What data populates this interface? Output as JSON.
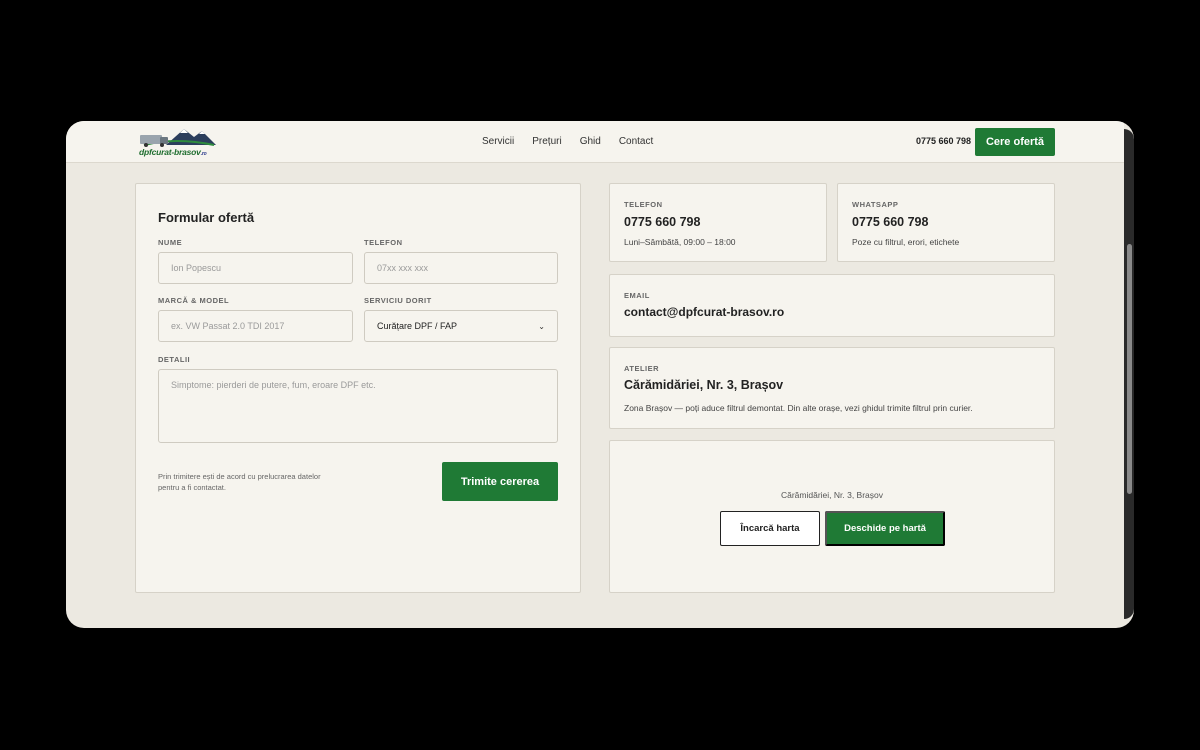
{
  "header": {
    "logo_text": "dpfcurat-brasov",
    "logo_tld": ".ro",
    "nav": [
      "Servicii",
      "Prețuri",
      "Ghid",
      "Contact"
    ],
    "phone": "0775 660 798",
    "cta_label": "Cere ofertă"
  },
  "form": {
    "title": "Formular ofertă",
    "name_label": "NUME",
    "name_placeholder": "Ion Popescu",
    "phone_label": "TELEFON",
    "phone_placeholder": "07xx xxx xxx",
    "model_label": "MARCĂ & MODEL",
    "model_placeholder": "ex. VW Passat 2.0 TDI 2017",
    "service_label": "SERVICIU DORIT",
    "service_value": "Curățare DPF / FAP",
    "details_label": "DETALII",
    "details_placeholder": "Simptome: pierderi de putere, fum, eroare DPF etc.",
    "consent": "Prin trimitere ești de acord cu prelucrarea datelor pentru a fi contactat.",
    "submit_label": "Trimite cererea"
  },
  "contact": {
    "phone": {
      "label": "TELEFON",
      "value": "0775 660 798",
      "note": "Luni–Sâmbătă, 09:00 – 18:00"
    },
    "whatsapp": {
      "label": "WHATSAPP",
      "value": "0775 660 798",
      "note": "Poze cu filtrul, erori, etichete"
    },
    "email": {
      "label": "EMAIL",
      "value": "contact@dpfcurat-brasov.ro"
    },
    "workshop": {
      "label": "ATELIER",
      "value": "Cărămidăriei, Nr. 3, Brașov",
      "note": "Zona Brașov — poți aduce filtrul demontat. Din alte orașe, vezi ghidul trimite filtrul prin curier."
    }
  },
  "map": {
    "address": "Cărămidăriei, Nr. 3, Brașov",
    "load_label": "Încarcă harta",
    "open_label": "Deschide pe hartă"
  },
  "colors": {
    "accent": "#1f7a35",
    "background": "#ece9e1",
    "panel": "#f6f4ee"
  }
}
